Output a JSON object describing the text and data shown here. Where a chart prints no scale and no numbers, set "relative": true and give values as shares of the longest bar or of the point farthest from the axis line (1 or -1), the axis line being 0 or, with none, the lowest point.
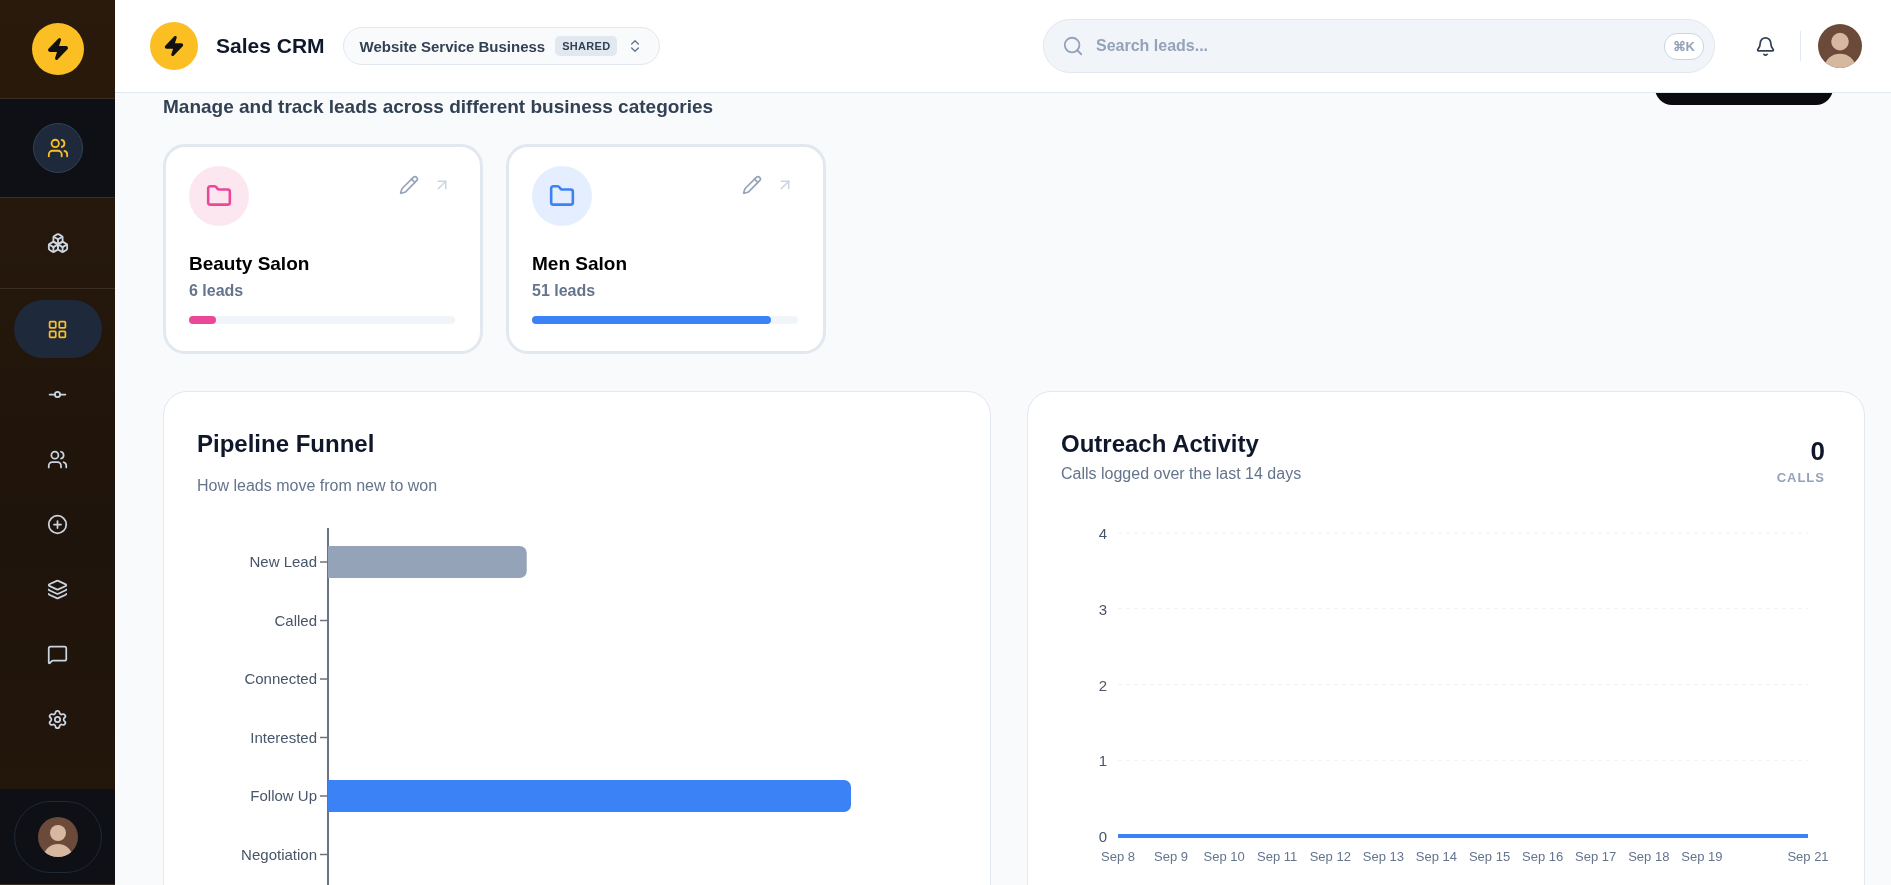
{
  "app": {
    "title": "Sales CRM"
  },
  "workspace": {
    "name": "Website Service Business",
    "badge": "SHARED"
  },
  "search": {
    "placeholder": "Search leads...",
    "shortcut": "⌘K"
  },
  "sidebar": {
    "nav": [
      {
        "selected": true
      },
      {
        "selected": false
      },
      {
        "selected": false
      },
      {
        "selected": false
      },
      {
        "selected": false
      },
      {
        "selected": false
      },
      {
        "selected": false
      }
    ]
  },
  "page": {
    "subtitle": "Manage and track leads across different business categories"
  },
  "categories": [
    {
      "name": "Beauty Salon",
      "count": "6 leads",
      "color": "#ec4899",
      "level": 0.1
    },
    {
      "name": "Men Salon",
      "count": "51 leads",
      "color": "#3b82f6",
      "level": 0.9
    }
  ],
  "pipeline": {
    "title": "Pipeline Funnel",
    "subtitle": "How leads move from new to won",
    "chart_data": {
      "type": "bar",
      "orientation": "horizontal",
      "relative": true,
      "categories": [
        "New Lead",
        "Called",
        "Connected",
        "Interested",
        "Follow Up",
        "Negotiation"
      ],
      "values": [
        0.38,
        0,
        0,
        0,
        1,
        0
      ]
    }
  },
  "outreach": {
    "title": "Outreach Activity",
    "subtitle": "Calls logged over the last 14 days",
    "total": "0",
    "total_label": "CALLS",
    "chart_data": {
      "type": "line",
      "categories": [
        "Sep 8",
        "Sep 9",
        "Sep 10",
        "Sep 11",
        "Sep 12",
        "Sep 13",
        "Sep 14",
        "Sep 15",
        "Sep 16",
        "Sep 17",
        "Sep 18",
        "Sep 19",
        null,
        "Sep 21"
      ],
      "series": [
        {
          "color": "#3b82f6",
          "values": [
            0,
            0,
            0,
            0,
            0,
            0,
            0,
            0,
            0,
            0,
            0,
            0,
            0,
            0
          ]
        }
      ],
      "ylim": [
        0,
        4
      ],
      "yticks": [
        0,
        1,
        2,
        3,
        4
      ],
      "grid": true
    }
  }
}
